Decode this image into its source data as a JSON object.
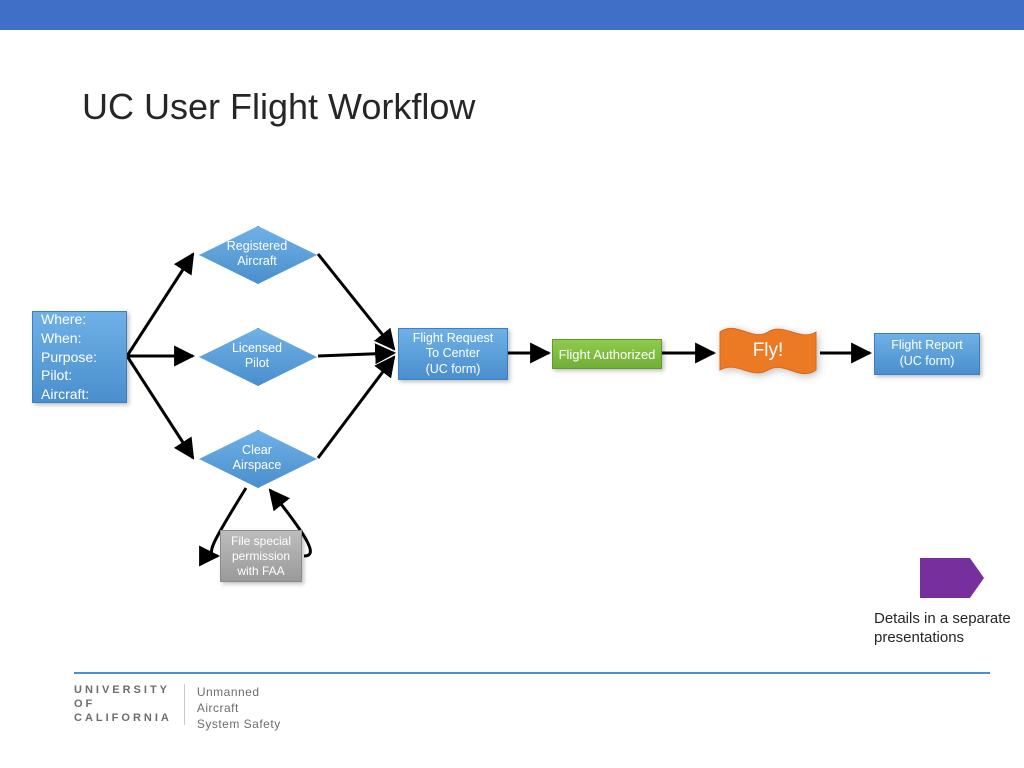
{
  "title": "UC User Flight Workflow",
  "nodes": {
    "start_lines": [
      "Where:",
      "When:",
      "Purpose:",
      "Pilot:",
      "Aircraft:"
    ],
    "registered_aircraft": "Registered\nAircraft",
    "licensed_pilot": "Licensed\nPilot",
    "clear_airspace": "Clear\nAirspace",
    "file_special": "File special\npermission\nwith FAA",
    "flight_request": "Flight Request\nTo Center\n(UC form)",
    "flight_authorized": "Flight Authorized",
    "fly": "Fly!",
    "flight_report": "Flight Report\n(UC form)"
  },
  "caption": "Details in a separate\npresentations",
  "footer": {
    "org_line1": "UNIVERSITY",
    "org_line2": "OF",
    "org_line3": "CALIFORNIA",
    "sub_line1": "Unmanned",
    "sub_line2": "Aircraft",
    "sub_line3": "System Safety"
  },
  "colors": {
    "band": "#3f6fc6",
    "blue_top": "#6fb1e6",
    "blue_bot": "#4a8fcd",
    "green_top": "#8fca4c",
    "green_bot": "#72af37",
    "orange": "#ec7a24",
    "purple": "#772f9e",
    "gray_top": "#bdbdbd",
    "gray_bot": "#9a9a9a"
  }
}
